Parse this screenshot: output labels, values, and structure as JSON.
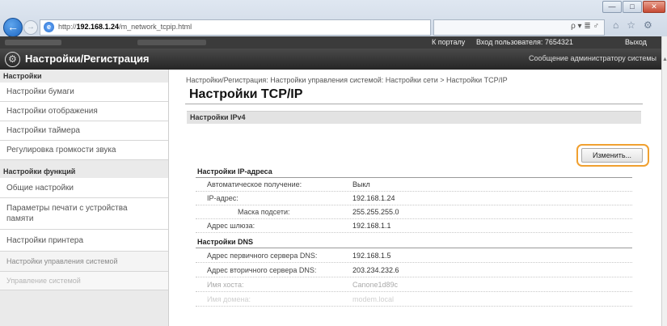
{
  "browser": {
    "url_prefix": "http://",
    "url_host": "192.168.1.24",
    "url_path": "/m_network_tcpip.html",
    "search_hint": "ρ ▾ ≣ ♂",
    "window_buttons": [
      "—",
      "□",
      "✕"
    ],
    "tool_icons": [
      "⌂",
      "☆",
      "⚙"
    ]
  },
  "topbar": {
    "portal_link": "К порталу",
    "login_text": "Вход пользователя:  7654321",
    "logout_link": "Выход"
  },
  "appbar": {
    "title": "Настройки/Регистрация",
    "admin_message": "Сообщение администратору системы"
  },
  "sidebar": {
    "section1": "Настройки",
    "items1": [
      "Настройки бумаги",
      "Настройки отображения",
      "Настройки таймера",
      "Регулировка громкости звука"
    ],
    "section2": "Настройки функций",
    "items2": [
      "Общие настройки",
      "Параметры печати с устройства памяти",
      "Настройки принтера",
      "Настройки управления системой",
      "Управление системой"
    ]
  },
  "main": {
    "breadcrumb": "Настройки/Регистрация: Настройки управления системой: Настройки сети > Настройки TCP/IP",
    "page_title": "Настройки TCP/IP",
    "section": "Настройки IPv4",
    "edit_button": "Изменить...",
    "ip_group": {
      "heading": "Настройки IP-адреса",
      "rows": [
        {
          "label": "Автоматическое получение:",
          "value": "Выкл"
        },
        {
          "label": "IP-адрес:",
          "value": "192.168.1.24"
        },
        {
          "label": "Маска подсети:",
          "value": "255.255.255.0"
        },
        {
          "label": "Адрес шлюза:",
          "value": "192.168.1.1"
        }
      ]
    },
    "dns_group": {
      "heading": "Настройки DNS",
      "rows": [
        {
          "label": "Адрес первичного сервера DNS:",
          "value": "192.168.1.5"
        },
        {
          "label": "Адрес вторичного сервера DNS:",
          "value": "203.234.232.6"
        },
        {
          "label": "Имя хоста:",
          "value": "Canone1d89c"
        },
        {
          "label": "Имя домена:",
          "value": "modem.local"
        }
      ]
    }
  },
  "colors": {
    "highlight": "#f0a030",
    "header_bg": "#262626"
  }
}
